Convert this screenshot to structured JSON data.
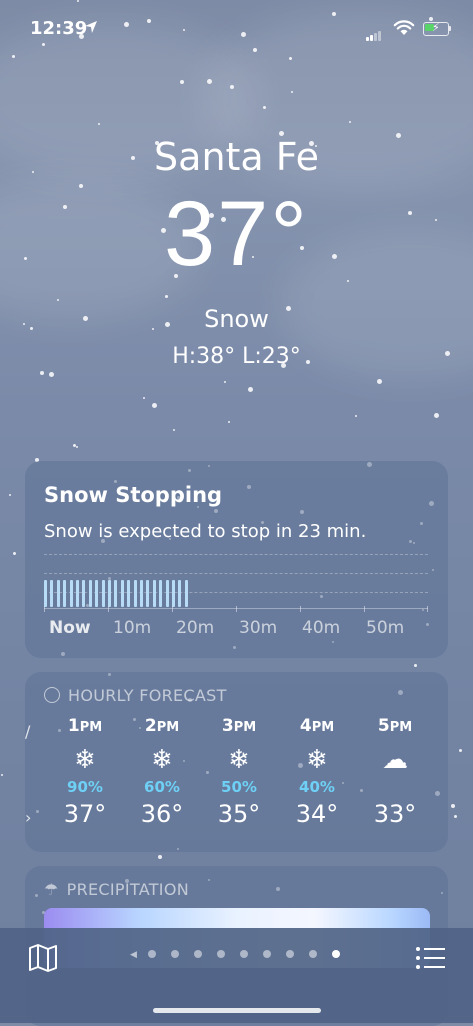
{
  "status_bar": {
    "time": "12:39"
  },
  "location": {
    "city": "Santa Fe",
    "temperature": "37°",
    "condition": "Snow",
    "hi_lo": "H:38°  L:23°"
  },
  "alert_card": {
    "title": "Snow Stopping",
    "subtitle": "Snow is expected to stop in 23 min.",
    "axis_labels": [
      "Now",
      "10m",
      "20m",
      "30m",
      "40m",
      "50m"
    ],
    "precip_minutes_remaining": 23
  },
  "hourly": {
    "header": "HOURLY FORECAST",
    "hours": [
      {
        "hour": "1",
        "ampm": "PM",
        "icon": "snowflake-icon",
        "glyph": "❄",
        "pop": "90%",
        "temp": "37°"
      },
      {
        "hour": "2",
        "ampm": "PM",
        "icon": "snowflake-icon",
        "glyph": "❄",
        "pop": "60%",
        "temp": "36°"
      },
      {
        "hour": "3",
        "ampm": "PM",
        "icon": "snowflake-icon",
        "glyph": "❄",
        "pop": "50%",
        "temp": "35°"
      },
      {
        "hour": "4",
        "ampm": "PM",
        "icon": "snowflake-icon",
        "glyph": "❄",
        "pop": "40%",
        "temp": "34°"
      },
      {
        "hour": "5",
        "ampm": "PM",
        "icon": "cloud-icon",
        "glyph": "☁",
        "pop": "",
        "temp": "33°"
      }
    ]
  },
  "precipitation": {
    "header": "PRECIPITATION"
  },
  "bottom_bar": {
    "page_count": 9,
    "active_page": 9
  },
  "colors": {
    "pop_text": "#6ed0f5",
    "precip_bar": "#b8dcf5"
  }
}
